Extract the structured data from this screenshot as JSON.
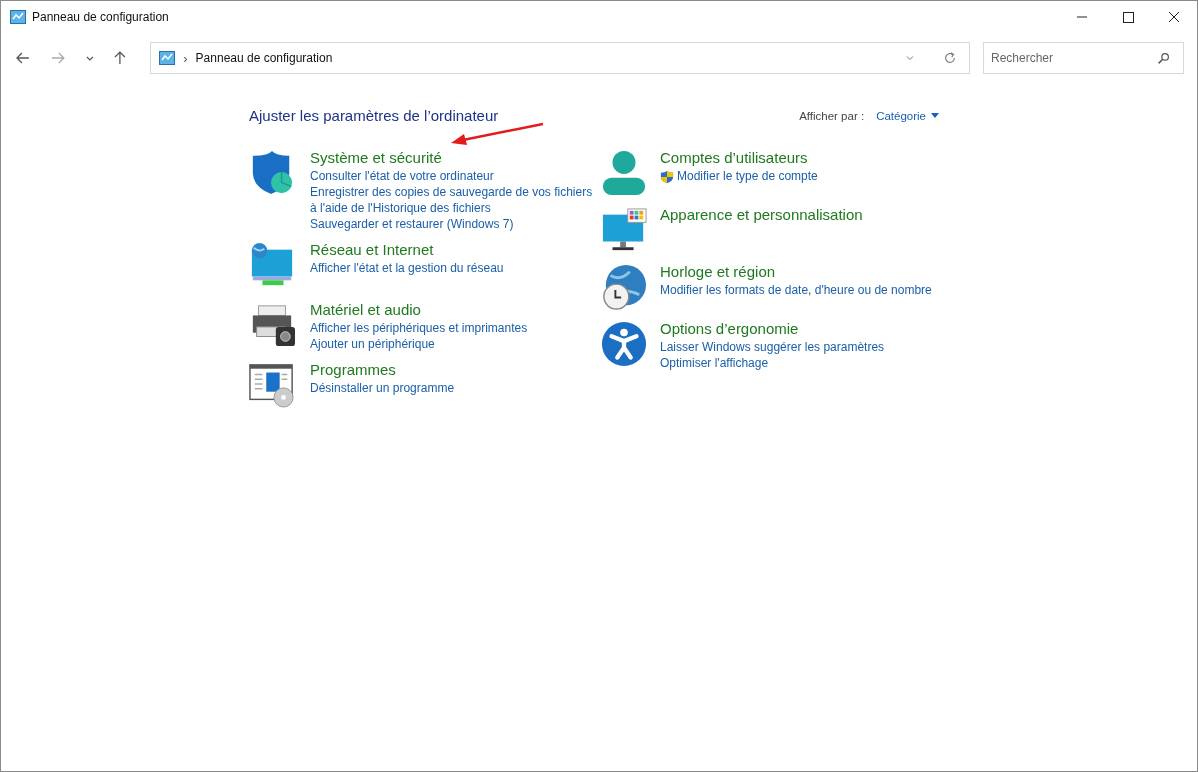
{
  "window": {
    "title": "Panneau de configuration"
  },
  "address_bar": {
    "path": "Panneau de configuration",
    "separator": "›"
  },
  "search": {
    "placeholder": "Rechercher"
  },
  "heading": "Ajuster les paramètres de l’ordinateur",
  "view_by": {
    "label": "Afficher par :",
    "value": "Catégorie"
  },
  "columns": [
    {
      "categories": [
        {
          "kind": "security",
          "title": "Système et sécurité",
          "links": [
            {
              "text": "Consulter l'état de votre ordinateur",
              "admin": false
            },
            {
              "text": "Enregistrer des copies de sauvegarde de vos fichiers à l'aide de l'Historique des fichiers",
              "admin": false
            },
            {
              "text": "Sauvegarder et restaurer (Windows 7)",
              "admin": false
            }
          ]
        },
        {
          "kind": "network",
          "title": "Réseau et Internet",
          "links": [
            {
              "text": "Afficher l'état et la gestion du réseau",
              "admin": false
            }
          ]
        },
        {
          "kind": "hardware",
          "title": "Matériel et audio",
          "links": [
            {
              "text": "Afficher les périphériques et imprimantes",
              "admin": false
            },
            {
              "text": "Ajouter un périphérique",
              "admin": false
            }
          ]
        },
        {
          "kind": "programs",
          "title": "Programmes",
          "links": [
            {
              "text": "Désinstaller un programme",
              "admin": false
            }
          ]
        }
      ]
    },
    {
      "categories": [
        {
          "kind": "users",
          "title": "Comptes d’utilisateurs",
          "links": [
            {
              "text": "Modifier le type de compte",
              "admin": true
            }
          ]
        },
        {
          "kind": "appearance",
          "title": "Apparence et personnalisation"
        },
        {
          "kind": "clock",
          "title": "Horloge et région",
          "links": [
            {
              "text": "Modifier les formats de date, d'heure ou de nombre",
              "admin": false
            }
          ]
        },
        {
          "kind": "accessibility",
          "title": "Options d’ergonomie",
          "links": [
            {
              "text": "Laisser Windows suggérer les paramètres",
              "admin": false
            },
            {
              "text": "Optimiser l'affichage",
              "admin": false
            }
          ]
        }
      ]
    }
  ]
}
